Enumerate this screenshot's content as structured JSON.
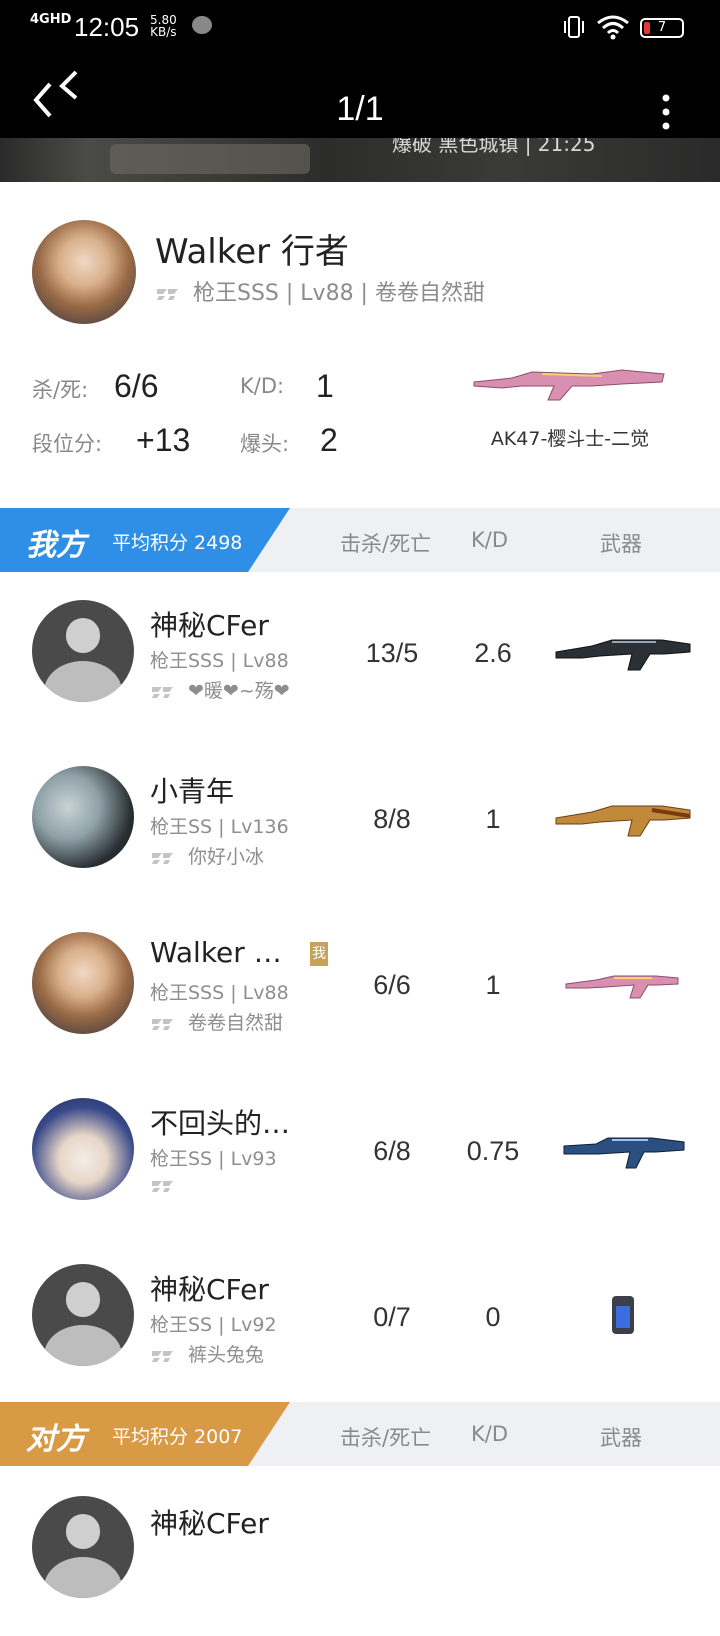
{
  "status_bar": {
    "network": "4GHD",
    "time": "12:05",
    "speed_value": "5.80",
    "speed_unit": "KB/s",
    "battery": "7"
  },
  "title_bar": {
    "title": "1/1"
  },
  "banner": {
    "map_text": "爆破 黑色城镇 | 21:25"
  },
  "me": {
    "name": "Walker  行者",
    "sub": "枪王SSS | Lv88 | 卷卷自然甜",
    "kill_death_label": "杀/死:",
    "kill_death": "6/6",
    "kd_label": "K/D:",
    "kd": "1",
    "rank_points_label": "段位分:",
    "rank_points": "+13",
    "headshot_label": "爆头:",
    "headshot": "2",
    "weapon": "AK47-樱斗士-二觉"
  },
  "my_team": {
    "label": "我方",
    "avg": "平均积分 2498",
    "col_kd": "击杀/死亡",
    "col_ratio": "K/D",
    "col_weapon": "武器",
    "color": "#2f8fe6",
    "players": [
      {
        "name": "神秘CFer",
        "rank": "枪王SSS | Lv88",
        "clan": "❤暖❤~殇❤",
        "kd": "13/5",
        "ratio": "2.6",
        "avatar": "default",
        "weapon": "dark-ak"
      },
      {
        "name": "小青年",
        "rank": "枪王SS | Lv136",
        "clan": "你好小冰",
        "kd": "8/8",
        "ratio": "1",
        "avatar": "photo",
        "weapon": "gold-ak"
      },
      {
        "name": "Walker  …",
        "rank": "枪王SSS | Lv88",
        "clan": "卷卷自然甜",
        "kd": "6/6",
        "ratio": "1",
        "avatar": "anime",
        "weapon": "pink-ak",
        "badge": "我"
      },
      {
        "name": "不回头的…",
        "rank": "枪王SS | Lv93",
        "clan": "",
        "kd": "6/8",
        "ratio": "0.75",
        "avatar": "cat",
        "weapon": "blue-m4"
      },
      {
        "name": "神秘CFer",
        "rank": "枪王SS | Lv92",
        "clan": "裤头兔兔",
        "kd": "0/7",
        "ratio": "0",
        "avatar": "default",
        "weapon": "armor"
      }
    ]
  },
  "enemy_team": {
    "label": "对方",
    "avg": "平均积分 2007",
    "col_kd": "击杀/死亡",
    "col_ratio": "K/D",
    "col_weapon": "武器",
    "color": "#d99a45",
    "players": [
      {
        "name": "神秘CFer"
      }
    ]
  }
}
